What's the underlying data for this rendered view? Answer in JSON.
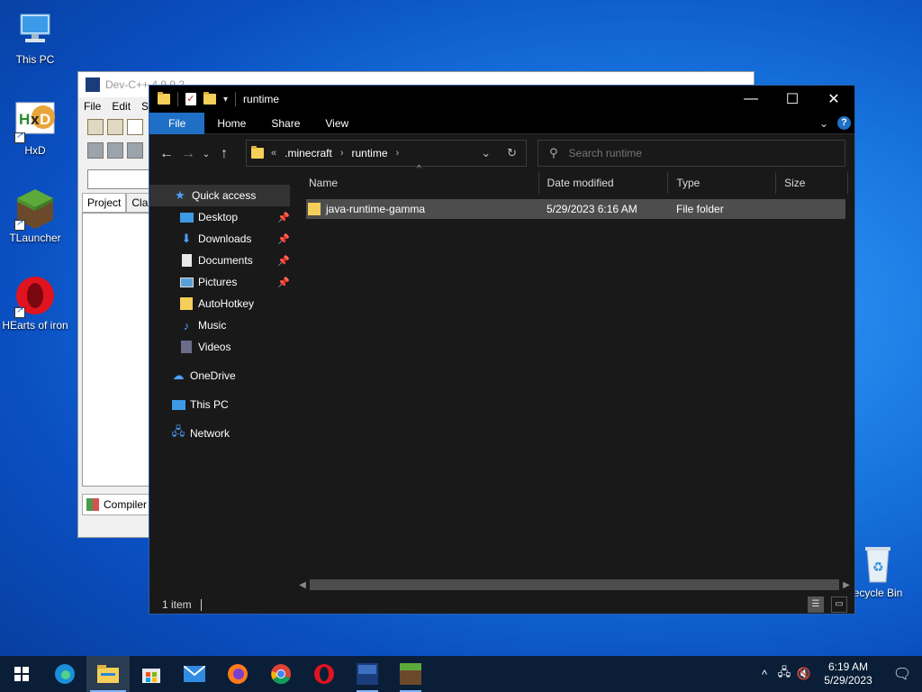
{
  "desktop": {
    "icons": [
      {
        "label": "This PC"
      },
      {
        "label": "HxD"
      },
      {
        "label": "TLauncher"
      },
      {
        "label": "HEarts of iron"
      },
      {
        "label": "ecycle Bin"
      }
    ]
  },
  "devcpp": {
    "title": "Dev-C++ 4.9.9.2",
    "menu": [
      "File",
      "Edit",
      "S"
    ],
    "tabs": [
      "Project",
      "Class"
    ],
    "compiler_label": "Compiler"
  },
  "explorer": {
    "title": "runtime",
    "ribbon": {
      "file": "File",
      "home": "Home",
      "share": "Share",
      "view": "View"
    },
    "address": {
      "overflow": "«",
      "crumbs": [
        ".minecraft",
        "runtime"
      ]
    },
    "search_placeholder": "Search runtime",
    "nav": {
      "quick_access": "Quick access",
      "items": [
        {
          "label": "Desktop",
          "pinned": true
        },
        {
          "label": "Downloads",
          "pinned": true
        },
        {
          "label": "Documents",
          "pinned": true
        },
        {
          "label": "Pictures",
          "pinned": true
        },
        {
          "label": "AutoHotkey",
          "pinned": false
        },
        {
          "label": "Music",
          "pinned": false
        },
        {
          "label": "Videos",
          "pinned": false
        }
      ],
      "onedrive": "OneDrive",
      "this_pc": "This PC",
      "network": "Network"
    },
    "columns": {
      "name": "Name",
      "date": "Date modified",
      "type": "Type",
      "size": "Size"
    },
    "files": [
      {
        "name": "java-runtime-gamma",
        "date": "5/29/2023 6:16 AM",
        "type": "File folder",
        "size": ""
      }
    ],
    "status": "1 item"
  },
  "taskbar": {
    "time": "6:19 AM",
    "date": "5/29/2023"
  },
  "colors": {
    "accent": "#1f6fc6",
    "explorer_bg": "#191919",
    "taskbar_bg": "#0a1e37",
    "folder": "#f4cf5a"
  }
}
